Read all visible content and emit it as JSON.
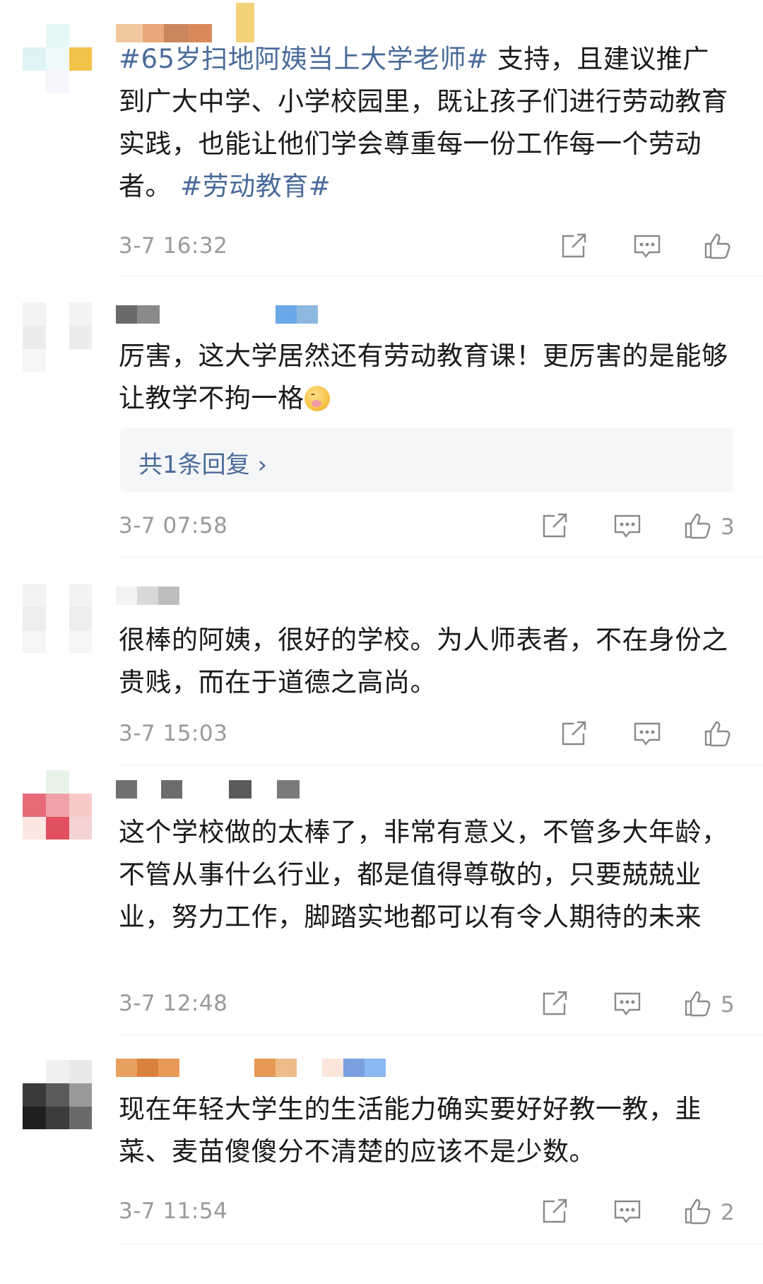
{
  "comments": [
    {
      "body": [
        {
          "text": "#65岁扫地阿姨当上大学老师#",
          "tag": true
        },
        {
          "text": " 支持，且建议推广到广大中学、小学校园里，既让孩子们进行劳动教育实践，也能让他们学会尊重每一份工作每一个劳动者。 ",
          "tag": false
        },
        {
          "text": "#劳动教育#",
          "tag": true
        }
      ],
      "time": "3-7 16:32",
      "likes": ""
    },
    {
      "body_text": "厉害，这大学居然还有劳动教育课！更厉害的是能够让教学不拘一格",
      "emoji": "shushing-face-emoji",
      "reply_label": "共1条回复 ›",
      "time": "3-7 07:58",
      "likes": "3"
    },
    {
      "body_text": "很棒的阿姨，很好的学校。为人师表者，不在身份之贵贱，而在于道德之高尚。",
      "time": "3-7 15:03",
      "likes": ""
    },
    {
      "body_text": "这个学校做的太棒了，非常有意义，不管多大年龄，不管从事什么行业，都是值得尊敬的，只要兢兢业业，努力工作，脚踏实地都可以有令人期待的未来",
      "time": "3-7 12:48",
      "likes": "5"
    },
    {
      "body_text": "现在年轻大学生的生活能力确实要好好教一教，韭菜、麦苗傻傻分不清楚的应该不是少数。",
      "time": "3-7 11:54",
      "likes": "2"
    }
  ],
  "colors": {
    "tag": "#4a6b9a",
    "meta": "#9a9a9a",
    "text": "#1a1a1a",
    "reply_bg": "#f5f6f7"
  },
  "icons": [
    "share-icon",
    "comment-icon",
    "like-icon"
  ]
}
